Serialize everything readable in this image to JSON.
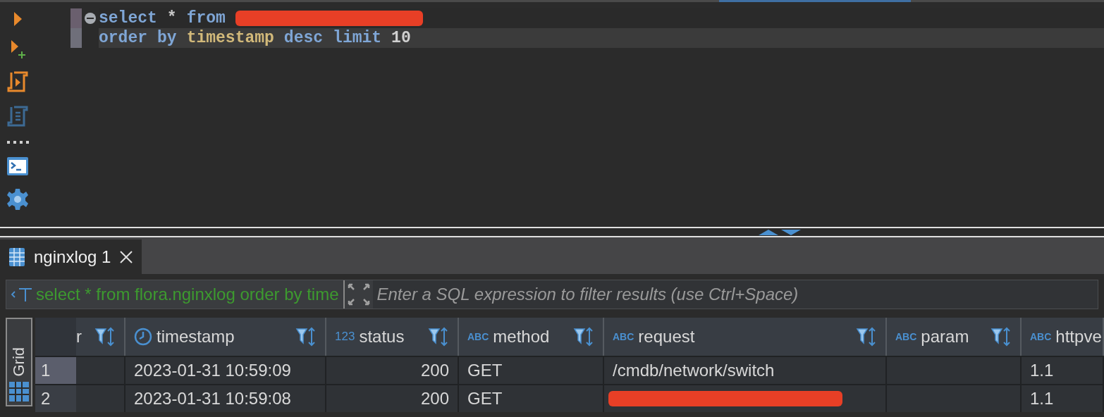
{
  "editor": {
    "lines": [
      {
        "current": false,
        "fold": true,
        "tokens": [
          {
            "kind": "keyword",
            "text": "select"
          },
          {
            "kind": "operator",
            "text": "*"
          },
          {
            "kind": "keyword",
            "text": "from"
          },
          {
            "kind": "redacted"
          }
        ]
      },
      {
        "current": true,
        "fold": false,
        "tokens": [
          {
            "kind": "keyword",
            "text": "order"
          },
          {
            "kind": "keyword",
            "text": "by"
          },
          {
            "kind": "identifier",
            "text": "timestamp"
          },
          {
            "kind": "keyword",
            "text": "desc"
          },
          {
            "kind": "keyword",
            "text": "limit"
          },
          {
            "kind": "number",
            "text": "10"
          }
        ]
      }
    ]
  },
  "results_tabs": [
    {
      "label": "nginxlog 1",
      "selected": true
    }
  ],
  "filter": {
    "query": "select * from flora.nginxlog order by time",
    "placeholder": "Enter a SQL expression to filter results (use Ctrl+Space)"
  },
  "view_tab": {
    "label": "Grid"
  },
  "table": {
    "columns": [
      {
        "label": "r",
        "kind": "none"
      },
      {
        "label": "timestamp",
        "kind": "time"
      },
      {
        "label": "status",
        "kind": "number",
        "type_label": "123"
      },
      {
        "label": "method",
        "kind": "string",
        "type_label": "ABC"
      },
      {
        "label": "request",
        "kind": "string",
        "type_label": "ABC"
      },
      {
        "label": "param",
        "kind": "string",
        "type_label": "ABC"
      },
      {
        "label": "httpve",
        "kind": "string",
        "type_label": "ABC"
      }
    ],
    "rows": [
      {
        "number": "1",
        "selected": true,
        "cells": [
          {
            "text": ""
          },
          {
            "text": "2023-01-31 10:59:09"
          },
          {
            "text": "200"
          },
          {
            "text": "GET"
          },
          {
            "text": "/cmdb/network/switch"
          },
          {
            "text": ""
          },
          {
            "text": "1.1"
          }
        ]
      },
      {
        "number": "2",
        "selected": false,
        "cells": [
          {
            "text": ""
          },
          {
            "text": "2023-01-31 10:59:08"
          },
          {
            "text": "200"
          },
          {
            "text": "GET"
          },
          {
            "text": "",
            "redacted": true
          },
          {
            "text": ""
          },
          {
            "text": "1.1"
          }
        ]
      }
    ]
  }
}
